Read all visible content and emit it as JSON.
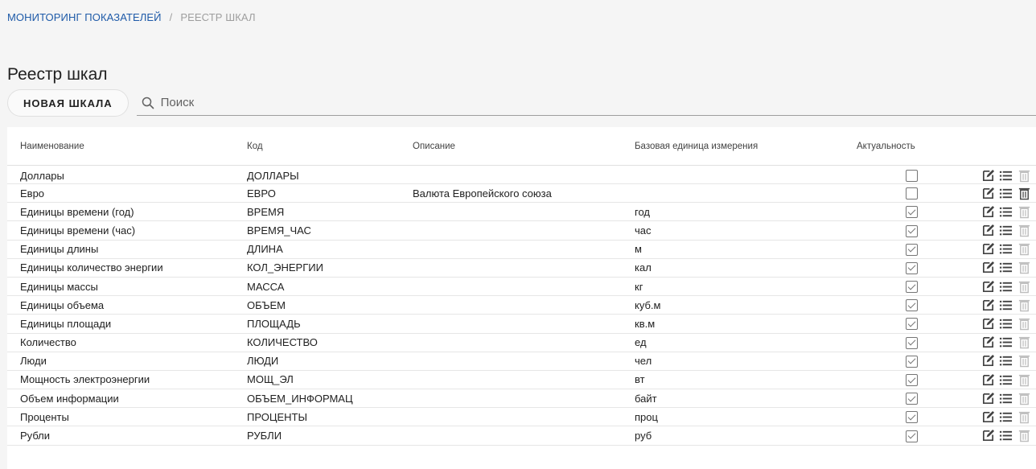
{
  "breadcrumb": {
    "root": "МОНИТОРИНГ ПОКАЗАТЕЛЕЙ",
    "separator": "/",
    "current": "РЕЕСТР ШКАЛ"
  },
  "page": {
    "title": "Реестр шкал"
  },
  "toolbar": {
    "new_button_label": "НОВАЯ ШКАЛА",
    "search_placeholder": "Поиск",
    "search_value": ""
  },
  "table": {
    "headers": {
      "name": "Наименование",
      "code": "Код",
      "description": "Описание",
      "base_unit": "Базовая единица измерения",
      "active": "Актуальность"
    },
    "rows": [
      {
        "name": "Доллары",
        "code": "ДОЛЛАРЫ",
        "description": "",
        "base_unit": "",
        "active": false,
        "delete_enabled": false
      },
      {
        "name": "Евро",
        "code": "ЕВРО",
        "description": "Валюта Европейского союза",
        "base_unit": "",
        "active": false,
        "delete_enabled": true
      },
      {
        "name": "Единицы времени (год)",
        "code": "ВРЕМЯ",
        "description": "",
        "base_unit": "год",
        "active": true,
        "delete_enabled": false
      },
      {
        "name": "Единицы времени (час)",
        "code": "ВРЕМЯ_ЧАС",
        "description": "",
        "base_unit": "час",
        "active": true,
        "delete_enabled": false
      },
      {
        "name": "Единицы длины",
        "code": "ДЛИНА",
        "description": "",
        "base_unit": "м",
        "active": true,
        "delete_enabled": false
      },
      {
        "name": "Единицы количество энергии",
        "code": "КОЛ_ЭНЕРГИИ",
        "description": "",
        "base_unit": "кал",
        "active": true,
        "delete_enabled": false
      },
      {
        "name": "Единицы массы",
        "code": "МАССА",
        "description": "",
        "base_unit": "кг",
        "active": true,
        "delete_enabled": false
      },
      {
        "name": "Единицы объема",
        "code": "ОБЪЕМ",
        "description": "",
        "base_unit": "куб.м",
        "active": true,
        "delete_enabled": false
      },
      {
        "name": "Единицы площади",
        "code": "ПЛОЩАДЬ",
        "description": "",
        "base_unit": "кв.м",
        "active": true,
        "delete_enabled": false
      },
      {
        "name": "Количество",
        "code": "КОЛИЧЕСТВО",
        "description": "",
        "base_unit": "ед",
        "active": true,
        "delete_enabled": false
      },
      {
        "name": "Люди",
        "code": "ЛЮДИ",
        "description": "",
        "base_unit": "чел",
        "active": true,
        "delete_enabled": false
      },
      {
        "name": "Мощность электроэнергии",
        "code": "МОЩ_ЭЛ",
        "description": "",
        "base_unit": "вт",
        "active": true,
        "delete_enabled": false
      },
      {
        "name": "Объем информации",
        "code": "ОБЪЕМ_ИНФОРМАЦ",
        "description": "",
        "base_unit": "байт",
        "active": true,
        "delete_enabled": false
      },
      {
        "name": "Проценты",
        "code": "ПРОЦЕНТЫ",
        "description": "",
        "base_unit": "проц",
        "active": true,
        "delete_enabled": false
      },
      {
        "name": "Рубли",
        "code": "РУБЛИ",
        "description": "",
        "base_unit": "руб",
        "active": true,
        "delete_enabled": false
      }
    ]
  },
  "row_icons": [
    "edit-icon",
    "list-icon",
    "delete-icon"
  ],
  "colors": {
    "breadcrumb_link": "#1e5aa8",
    "icon_active": "#424242",
    "icon_disabled": "#bdbdbd"
  }
}
